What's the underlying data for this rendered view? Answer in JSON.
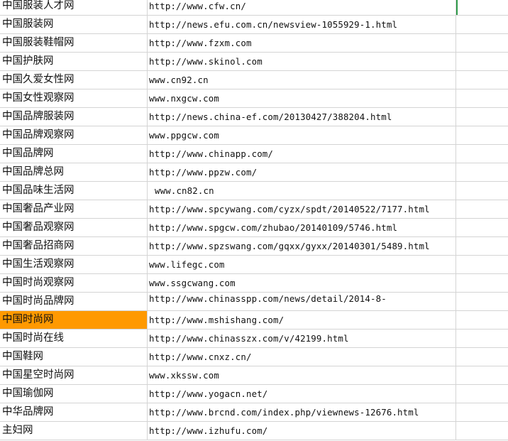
{
  "rows": [
    {
      "name": "中国服装人才网",
      "url": "http://www.cfw.cn/"
    },
    {
      "name": "中国服装网",
      "url": "http://news.efu.com.cn/newsview-1055929-1.html"
    },
    {
      "name": "中国服装鞋帽网",
      "url": "http://www.fzxm.com"
    },
    {
      "name": "中国护肤网",
      "url": "http://www.skinol.com"
    },
    {
      "name": "中国久爱女性网",
      "url": "www.cn92.cn"
    },
    {
      "name": "中国女性观察网",
      "url": "www.nxgcw.com"
    },
    {
      "name": "中国品牌服装网",
      "url": "http://news.china-ef.com/20130427/388204.html"
    },
    {
      "name": "中国品牌观察网",
      "url": "www.ppgcw.com"
    },
    {
      "name": "中国品牌网",
      "url": "http://www.chinapp.com/"
    },
    {
      "name": "中国品牌总网",
      "url": "http://www.ppzw.com/"
    },
    {
      "name": "中国品味生活网",
      "url": "www.cn82.cn"
    },
    {
      "name": "中国奢品产业网",
      "url": "http://www.spcywang.com/cyzx/spdt/20140522/7177.html"
    },
    {
      "name": "中国奢品观察网",
      "url": "http://www.spgcw.com/zhubao/20140109/5746.html"
    },
    {
      "name": "中国奢品招商网",
      "url": "http://www.spzswang.com/gqxx/gyxx/20140301/5489.html"
    },
    {
      "name": "中国生活观察网",
      "url": "www.lifegc.com"
    },
    {
      "name": "中国时尚观察网",
      "url": "www.ssgcwang.com"
    },
    {
      "name": "中国时尚品牌网",
      "url": "http://www.chinasspp.com/news/detail/2014-8-"
    },
    {
      "name": "中国时尚网",
      "url": "http://www.mshishang.com/"
    },
    {
      "name": "中国时尚在线",
      "url": "http://www.chinasszx.com/v/42199.html"
    },
    {
      "name": "中国鞋网",
      "url": "http://www.cnxz.cn/"
    },
    {
      "name": "中国星空时尚网",
      "url": "www.xkssw.com"
    },
    {
      "name": "中国瑜伽网",
      "url": "http://www.yogacn.net/"
    },
    {
      "name": "中华品牌网",
      "url": "http://www.brcnd.com/index.php/viewnews-12676.html"
    },
    {
      "name": "主妇网",
      "url": "http://www.izhufu.com/"
    }
  ],
  "colors": {
    "highlight": "#ff9900",
    "gridline": "#d4d4d4",
    "selection_border": "#2f9a4a"
  }
}
